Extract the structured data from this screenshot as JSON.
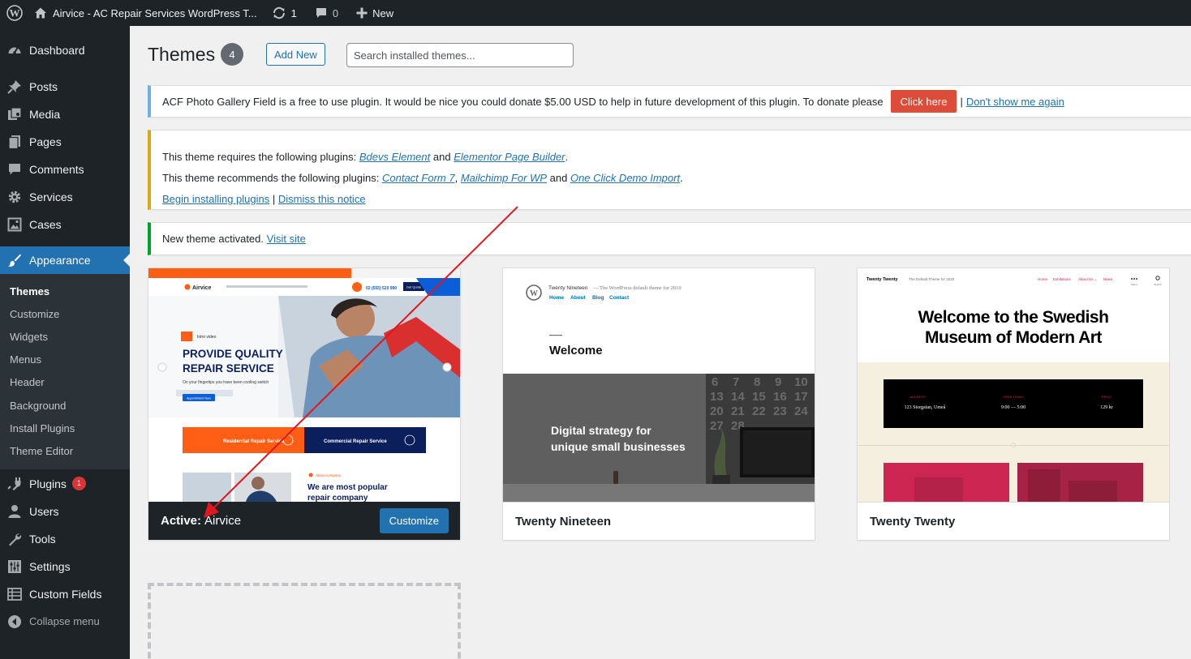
{
  "admin_bar": {
    "site_title": "Airvice - AC Repair Services WordPress T...",
    "updates_count": "1",
    "comments_count": "0",
    "new_label": "New"
  },
  "sidebar": {
    "items": [
      {
        "label": "Dashboard",
        "icon": "dashboard-icon"
      },
      {
        "label": "Posts",
        "icon": "pin-icon"
      },
      {
        "label": "Media",
        "icon": "media-icon"
      },
      {
        "label": "Pages",
        "icon": "pages-icon"
      },
      {
        "label": "Comments",
        "icon": "comment-icon"
      },
      {
        "label": "Services",
        "icon": "gear-icon"
      },
      {
        "label": "Cases",
        "icon": "image-icon"
      },
      {
        "label": "Appearance",
        "icon": "paintbrush-icon"
      },
      {
        "label": "Plugins",
        "icon": "plug-icon",
        "badge": "1"
      },
      {
        "label": "Users",
        "icon": "user-icon"
      },
      {
        "label": "Tools",
        "icon": "wrench-icon"
      },
      {
        "label": "Settings",
        "icon": "settings-icon"
      },
      {
        "label": "Custom Fields",
        "icon": "table-icon"
      }
    ],
    "appearance_submenu": [
      "Themes",
      "Customize",
      "Widgets",
      "Menus",
      "Header",
      "Background",
      "Install Plugins",
      "Theme Editor"
    ],
    "collapse_label": "Collapse menu"
  },
  "page": {
    "title": "Themes",
    "count": "4",
    "add_new_label": "Add New",
    "search_placeholder": "Search installed themes..."
  },
  "notices": {
    "acf": {
      "text": "ACF Photo Gallery Field is a free to use plugin. It would be nice you could donate $5.00 USD to help in future development of this plugin. To donate please",
      "donate_label": "Click here",
      "separator": "|",
      "dismiss_label": "Don't show me again"
    },
    "plugins": {
      "requires_prefix": "This theme requires the following plugins:",
      "required_1": "Bdevs Element",
      "and_1": "and",
      "required_2": "Elementor Page Builder",
      "period": ".",
      "recommends_prefix": "This theme recommends the following plugins:",
      "recommended_1": "Contact Form 7",
      "comma": ",",
      "recommended_2": "Mailchimp For WP",
      "and_2": "and",
      "recommended_3": "One Click Demo Import",
      "begin_label": "Begin installing plugins",
      "separator": "|",
      "dismiss_label": "Dismiss this notice"
    },
    "activated": {
      "text": "New theme activated.",
      "link": "Visit site"
    }
  },
  "themes": [
    {
      "name": "Airvice",
      "active_label": "Active:",
      "customize_label": "Customize",
      "screenshot": {
        "brand": "Airvice",
        "phone": "02 (555) 520 990",
        "quote_btn": "Get Quote",
        "hero_tag": "Intro video",
        "hero_line1": "PROVIDE QUALITY",
        "hero_line2": "REPAIR SERVICE",
        "hero_sub": "On your fingertips you have been cooling switch",
        "hero_btn": "Appointment Now",
        "service_1": "Residential Repair Service",
        "service_2": "Commercial Repair Service",
        "about_tag": "About company",
        "about_line1": "We are most popular",
        "about_line2": "repair company"
      }
    },
    {
      "name": "Twenty Nineteen",
      "screenshot": {
        "site_name": "Twenty Nineteen",
        "tagline": "— The WordPress default theme for 2019",
        "nav": [
          "Home",
          "About",
          "Blog",
          "Contact"
        ],
        "welcome": "Welcome",
        "hero_line1": "Digital strategy for",
        "hero_line2": "unique small businesses",
        "calendar": [
          "6",
          "7",
          "8",
          "9",
          "10",
          "13",
          "14",
          "15",
          "16",
          "17",
          "20",
          "21",
          "22",
          "23",
          "24",
          "27",
          "28"
        ]
      }
    },
    {
      "name": "Twenty Twenty",
      "screenshot": {
        "site_name": "Twenty Twenty",
        "tagline": "The Default Theme for 2020",
        "nav": [
          "Home",
          "Exhibitions",
          "About Us ⌄",
          "News"
        ],
        "menu_label": "Menu",
        "search_label": "Search",
        "headline_1": "Welcome to the Swedish",
        "headline_2": "Museum of Modern Art",
        "info": [
          {
            "label": "ADDRESS",
            "value": "123 Storgatan, Umeå"
          },
          {
            "label": "OPEN TODAY",
            "value": "9:00 — 5:00"
          },
          {
            "label": "PRICE",
            "value": "129 kr"
          }
        ]
      }
    }
  ],
  "colors": {
    "admin_dark": "#1d2327",
    "accent_blue": "#2271b1",
    "badge_red": "#d63638",
    "donate_red": "#dd4b39",
    "warning_yellow": "#dba617",
    "success_green": "#00a32a",
    "annotation_red": "#e0191e"
  }
}
